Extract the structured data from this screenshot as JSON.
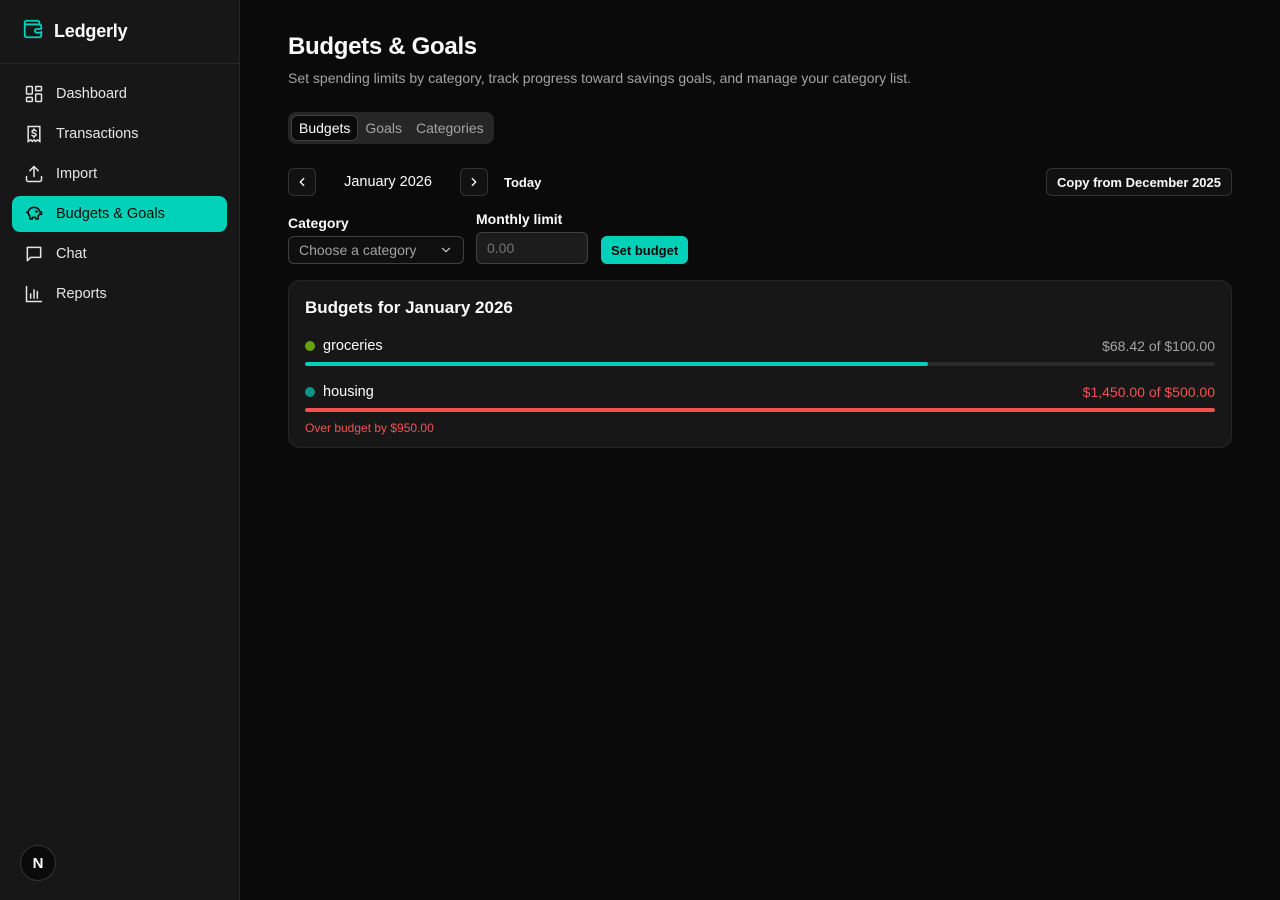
{
  "app": {
    "name": "Ledgerly",
    "accent": "#00d1b8",
    "danger": "#f05252"
  },
  "sidebar": {
    "items": [
      {
        "label": "Dashboard",
        "icon": "dashboard-grid-icon",
        "active": false
      },
      {
        "label": "Transactions",
        "icon": "receipt-dollar-icon",
        "active": false
      },
      {
        "label": "Import",
        "icon": "upload-icon",
        "active": false
      },
      {
        "label": "Budgets & Goals",
        "icon": "piggy-bank-icon",
        "active": true
      },
      {
        "label": "Chat",
        "icon": "chat-bubble-icon",
        "active": false
      },
      {
        "label": "Reports",
        "icon": "bar-chart-icon",
        "active": false
      }
    ],
    "avatar_letter": "N"
  },
  "page": {
    "title": "Budgets & Goals",
    "description": "Set spending limits by category, track progress toward savings goals, and manage your category list."
  },
  "tabs": [
    {
      "label": "Budgets",
      "active": true
    },
    {
      "label": "Goals",
      "active": false
    },
    {
      "label": "Categories",
      "active": false
    }
  ],
  "month_nav": {
    "month": "January 2026",
    "today_label": "Today",
    "copy_label": "Copy from December 2025"
  },
  "form": {
    "category_label": "Category",
    "category_placeholder": "Choose a category",
    "limit_label": "Monthly limit",
    "limit_placeholder": "0.00",
    "submit_label": "Set budget"
  },
  "budgets": {
    "title": "Budgets for January 2026",
    "rows": [
      {
        "name": "groceries",
        "dot_color": "#65a30d",
        "amount_text": "$68.42 of $100.00",
        "progress": 0.6842,
        "over": false,
        "note": ""
      },
      {
        "name": "housing",
        "dot_color": "#0d9488",
        "amount_text": "$1,450.00 of $500.00",
        "progress": 1.0,
        "over": true,
        "note": "Over budget by $950.00"
      }
    ]
  }
}
